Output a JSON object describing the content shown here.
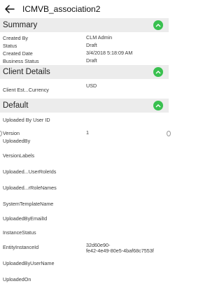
{
  "header": {
    "title": "ICMVB_association2"
  },
  "summary": {
    "title": "Summary",
    "rows": [
      {
        "label": "Created By",
        "value": "CLM Admin"
      },
      {
        "label": "Status",
        "value": "Draft"
      },
      {
        "label": "Created Date",
        "value": "3/4/2018 5:18:09 AM"
      },
      {
        "label": "Business Status",
        "value": "Draft"
      }
    ]
  },
  "client_details": {
    "title": "Client Details",
    "rows": [
      {
        "label": "Client Est...Currency",
        "value": "USD"
      }
    ]
  },
  "default": {
    "title": "Default",
    "rows": [
      {
        "label": "Uploaded By User ID",
        "value": ""
      },
      {
        "label": "Version",
        "value": "1"
      },
      {
        "label": "UploadedBy",
        "value": ""
      },
      {
        "label": "VersionLabels",
        "value": ""
      },
      {
        "label": "Uploaded...UserRoleIds",
        "value": ""
      },
      {
        "label": "Uploaded...rRoleNames",
        "value": ""
      },
      {
        "label": "SystemTemplateName",
        "value": ""
      },
      {
        "label": "UploadedByEmailId",
        "value": ""
      },
      {
        "label": "InstanceStatus",
        "value": ""
      },
      {
        "label": "EntityInstanceId",
        "value": "32d60e90-",
        "value2": "fe42-4e49-80e5-4baf68c7553f"
      },
      {
        "label": "UploadedByUserName",
        "value": ""
      },
      {
        "label": "UploadedOn",
        "value": ""
      }
    ]
  },
  "colors": {
    "accent": "#39c04f",
    "section_bg": "#ececec"
  },
  "icons": {
    "back": "back-arrow-icon",
    "toggle": "chevron-up-icon"
  }
}
